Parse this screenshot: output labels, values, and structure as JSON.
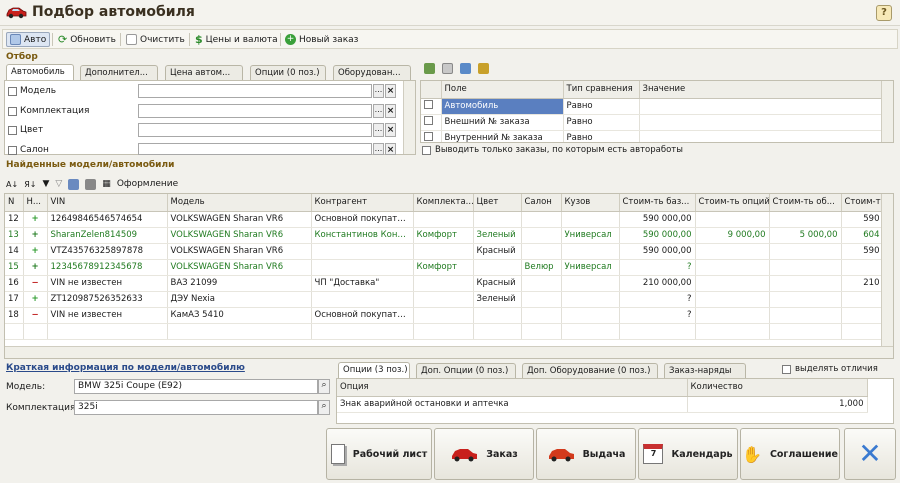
{
  "window": {
    "title": "Подбор автомобиля",
    "help": "?"
  },
  "toolbar": {
    "auto": "Авто",
    "refresh": "Обновить",
    "clear": "Очистить",
    "prices": "Цены и валюта",
    "new_order": "Новый заказ"
  },
  "filter": {
    "section": "Отбор",
    "tabs": [
      "Автомобиль",
      "Дополнител...",
      "Цена автом...",
      "Опции (0 поз.)",
      "Оборудован..."
    ],
    "fields": [
      "Модель",
      "Комплектация",
      "Цвет",
      "Салон"
    ],
    "grid_headers": [
      "Поле",
      "Тип сравнения",
      "Значение"
    ],
    "grid_rows": [
      [
        "Автомобиль",
        "Равно"
      ],
      [
        "Внешний № заказа",
        "Равно"
      ],
      [
        "Внутренний № заказа",
        "Равно"
      ]
    ],
    "only_orders_label": "Выводить только заказы, по которым есть автоработы"
  },
  "found": {
    "section": "Найденные модели/автомобили",
    "format_label": "Оформление",
    "headers": [
      "N",
      "Н...",
      "VIN",
      "Модель",
      "Контрагент",
      "Комплекта...",
      "Цвет",
      "Салон",
      "Кузов",
      "Стоим-ть баз...",
      "Стоим-ть опций",
      "Стоим-ть об...",
      "Стоим-ть"
    ],
    "rows": [
      {
        "n": "12",
        "mark": "+",
        "vin": "12649846546574654",
        "model": "VOLKSWAGEN Sharan VR6",
        "agent": "Основной покупате...",
        "compl": "",
        "color": "",
        "salon": "",
        "body": "",
        "base": "590 000,00",
        "opts": "",
        "equip": "",
        "total": "590",
        "green": false
      },
      {
        "n": "13",
        "mark": "+",
        "vin": "SharanZelen814509",
        "model": "VOLKSWAGEN Sharan VR6",
        "agent": "Константинов Конс...",
        "compl": "Комфорт",
        "color": "Зеленый",
        "salon": "",
        "body": "Универсал",
        "base": "590 000,00",
        "opts": "9 000,00",
        "equip": "5 000,00",
        "total": "604",
        "green": true
      },
      {
        "n": "14",
        "mark": "+",
        "vin": "VTZ43576325897878",
        "model": "VOLKSWAGEN Sharan VR6",
        "agent": "",
        "compl": "",
        "color": "Красный",
        "salon": "",
        "body": "",
        "base": "590 000,00",
        "opts": "",
        "equip": "",
        "total": "590",
        "green": false
      },
      {
        "n": "15",
        "mark": "+",
        "vin": "12345678912345678",
        "model": "VOLKSWAGEN Sharan VR6",
        "agent": "",
        "compl": "Комфорт",
        "color": "",
        "salon": "Велюр",
        "body": "Универсал",
        "base": "?",
        "opts": "",
        "equip": "",
        "total": "",
        "green": true
      },
      {
        "n": "16",
        "mark": "−",
        "vin": "VIN не известен",
        "model": "ВАЗ 21099",
        "agent": "ЧП \"Доставка\"",
        "compl": "",
        "color": "Красный",
        "salon": "",
        "body": "",
        "base": "210 000,00",
        "opts": "",
        "equip": "",
        "total": "210",
        "green": false
      },
      {
        "n": "17",
        "mark": "+",
        "vin": "ZT120987526352633",
        "model": "ДЭУ Nexia",
        "agent": "",
        "compl": "",
        "color": "Зеленый",
        "salon": "",
        "body": "",
        "base": "?",
        "opts": "",
        "equip": "",
        "total": "",
        "green": false
      },
      {
        "n": "18",
        "mark": "−",
        "vin": "VIN не известен",
        "model": "КамАЗ 5410",
        "agent": "Основной покупате...",
        "compl": "",
        "color": "",
        "salon": "",
        "body": "",
        "base": "?",
        "opts": "",
        "equip": "",
        "total": "",
        "green": false
      }
    ]
  },
  "info": {
    "title": "Краткая информация по модели/автомобилю",
    "model_label": "Модель:",
    "model_value": "BMW 325i Coupe (E92)",
    "compl_label": "Комплектация:",
    "compl_value": "325i"
  },
  "options": {
    "tabs": [
      "Опции (3 поз.)",
      "Доп. Опции (0 поз.)",
      "Доп. Оборудование (0 поз.)",
      "Заказ-наряды"
    ],
    "highlight_label": "выделять отличия",
    "headers": [
      "Опция",
      "Количество"
    ],
    "rows": [
      [
        "Знак аварийной остановки и аптечка",
        "1,000"
      ]
    ]
  },
  "actions": {
    "worksheet": "Рабочий лист",
    "order": "Заказ",
    "issue": "Выдача",
    "calendar": "Календарь",
    "agreement": "Соглашение"
  },
  "colors": {
    "selection": "#5a7fc0",
    "green_row": "#1f7a1f",
    "section": "#7a5a10"
  }
}
